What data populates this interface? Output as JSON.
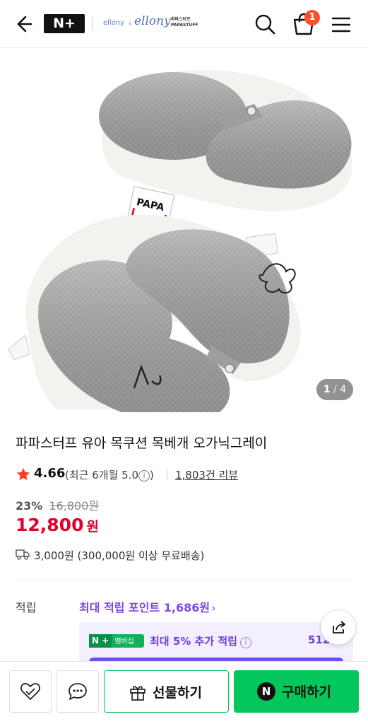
{
  "header": {
    "brand_badge": "N+",
    "brands": [
      "ellony",
      "ellony",
      "파파스터프 PAPASTUFF"
    ],
    "cart_count": "1",
    "icons": [
      "back-arrow-icon",
      "search-icon",
      "cart-icon",
      "hamburger-menu-icon"
    ]
  },
  "gallery": {
    "current": "1",
    "separator": "/",
    "total": "4",
    "tag_text": "PAPA"
  },
  "product": {
    "title": "파파스터프 유아 목쿠션 목베개 오가닉그레이",
    "rating": "4.66",
    "recent_rating": "(최근 6개월 5.0",
    "recent_close": ")",
    "reviews": "1,803건 리뷰",
    "discount_pct": "23%",
    "original_price": "16,800원",
    "price": "12,800",
    "price_unit": "원",
    "shipping": "3,000원 (300,000원 이상 무료배송)"
  },
  "points": {
    "label": "적립",
    "max_text": "최대 적립 포인트 1,686원",
    "chevron": "›",
    "member_badge_np": "N +",
    "member_badge_label": "멤버십",
    "member_label": "최대 5% 추가 적립",
    "member_amount": "512"
  },
  "bottom_bar": {
    "gift_label": "선물하기",
    "buy_logo": "N",
    "buy_label": "구매하기"
  },
  "colors": {
    "price_red": "#e0002a",
    "naver_green": "#03c75a",
    "points_purple": "#7b47e8",
    "badge_orange": "#ff4e2e"
  }
}
